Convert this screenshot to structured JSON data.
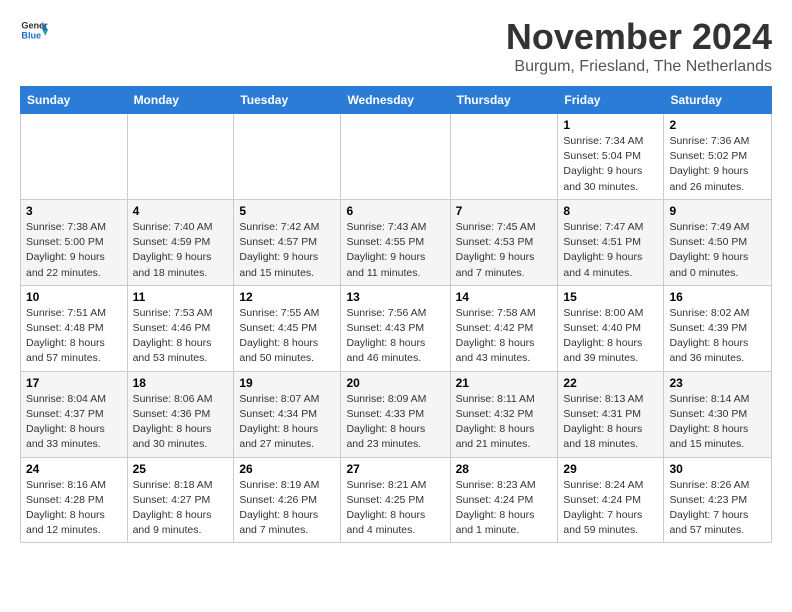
{
  "header": {
    "logo_general": "General",
    "logo_blue": "Blue",
    "month_title": "November 2024",
    "location": "Burgum, Friesland, The Netherlands"
  },
  "weekdays": [
    "Sunday",
    "Monday",
    "Tuesday",
    "Wednesday",
    "Thursday",
    "Friday",
    "Saturday"
  ],
  "weeks": [
    [
      {
        "day": "",
        "info": ""
      },
      {
        "day": "",
        "info": ""
      },
      {
        "day": "",
        "info": ""
      },
      {
        "day": "",
        "info": ""
      },
      {
        "day": "",
        "info": ""
      },
      {
        "day": "1",
        "info": "Sunrise: 7:34 AM\nSunset: 5:04 PM\nDaylight: 9 hours and 30 minutes."
      },
      {
        "day": "2",
        "info": "Sunrise: 7:36 AM\nSunset: 5:02 PM\nDaylight: 9 hours and 26 minutes."
      }
    ],
    [
      {
        "day": "3",
        "info": "Sunrise: 7:38 AM\nSunset: 5:00 PM\nDaylight: 9 hours and 22 minutes."
      },
      {
        "day": "4",
        "info": "Sunrise: 7:40 AM\nSunset: 4:59 PM\nDaylight: 9 hours and 18 minutes."
      },
      {
        "day": "5",
        "info": "Sunrise: 7:42 AM\nSunset: 4:57 PM\nDaylight: 9 hours and 15 minutes."
      },
      {
        "day": "6",
        "info": "Sunrise: 7:43 AM\nSunset: 4:55 PM\nDaylight: 9 hours and 11 minutes."
      },
      {
        "day": "7",
        "info": "Sunrise: 7:45 AM\nSunset: 4:53 PM\nDaylight: 9 hours and 7 minutes."
      },
      {
        "day": "8",
        "info": "Sunrise: 7:47 AM\nSunset: 4:51 PM\nDaylight: 9 hours and 4 minutes."
      },
      {
        "day": "9",
        "info": "Sunrise: 7:49 AM\nSunset: 4:50 PM\nDaylight: 9 hours and 0 minutes."
      }
    ],
    [
      {
        "day": "10",
        "info": "Sunrise: 7:51 AM\nSunset: 4:48 PM\nDaylight: 8 hours and 57 minutes."
      },
      {
        "day": "11",
        "info": "Sunrise: 7:53 AM\nSunset: 4:46 PM\nDaylight: 8 hours and 53 minutes."
      },
      {
        "day": "12",
        "info": "Sunrise: 7:55 AM\nSunset: 4:45 PM\nDaylight: 8 hours and 50 minutes."
      },
      {
        "day": "13",
        "info": "Sunrise: 7:56 AM\nSunset: 4:43 PM\nDaylight: 8 hours and 46 minutes."
      },
      {
        "day": "14",
        "info": "Sunrise: 7:58 AM\nSunset: 4:42 PM\nDaylight: 8 hours and 43 minutes."
      },
      {
        "day": "15",
        "info": "Sunrise: 8:00 AM\nSunset: 4:40 PM\nDaylight: 8 hours and 39 minutes."
      },
      {
        "day": "16",
        "info": "Sunrise: 8:02 AM\nSunset: 4:39 PM\nDaylight: 8 hours and 36 minutes."
      }
    ],
    [
      {
        "day": "17",
        "info": "Sunrise: 8:04 AM\nSunset: 4:37 PM\nDaylight: 8 hours and 33 minutes."
      },
      {
        "day": "18",
        "info": "Sunrise: 8:06 AM\nSunset: 4:36 PM\nDaylight: 8 hours and 30 minutes."
      },
      {
        "day": "19",
        "info": "Sunrise: 8:07 AM\nSunset: 4:34 PM\nDaylight: 8 hours and 27 minutes."
      },
      {
        "day": "20",
        "info": "Sunrise: 8:09 AM\nSunset: 4:33 PM\nDaylight: 8 hours and 23 minutes."
      },
      {
        "day": "21",
        "info": "Sunrise: 8:11 AM\nSunset: 4:32 PM\nDaylight: 8 hours and 21 minutes."
      },
      {
        "day": "22",
        "info": "Sunrise: 8:13 AM\nSunset: 4:31 PM\nDaylight: 8 hours and 18 minutes."
      },
      {
        "day": "23",
        "info": "Sunrise: 8:14 AM\nSunset: 4:30 PM\nDaylight: 8 hours and 15 minutes."
      }
    ],
    [
      {
        "day": "24",
        "info": "Sunrise: 8:16 AM\nSunset: 4:28 PM\nDaylight: 8 hours and 12 minutes."
      },
      {
        "day": "25",
        "info": "Sunrise: 8:18 AM\nSunset: 4:27 PM\nDaylight: 8 hours and 9 minutes."
      },
      {
        "day": "26",
        "info": "Sunrise: 8:19 AM\nSunset: 4:26 PM\nDaylight: 8 hours and 7 minutes."
      },
      {
        "day": "27",
        "info": "Sunrise: 8:21 AM\nSunset: 4:25 PM\nDaylight: 8 hours and 4 minutes."
      },
      {
        "day": "28",
        "info": "Sunrise: 8:23 AM\nSunset: 4:24 PM\nDaylight: 8 hours and 1 minute."
      },
      {
        "day": "29",
        "info": "Sunrise: 8:24 AM\nSunset: 4:24 PM\nDaylight: 7 hours and 59 minutes."
      },
      {
        "day": "30",
        "info": "Sunrise: 8:26 AM\nSunset: 4:23 PM\nDaylight: 7 hours and 57 minutes."
      }
    ]
  ]
}
